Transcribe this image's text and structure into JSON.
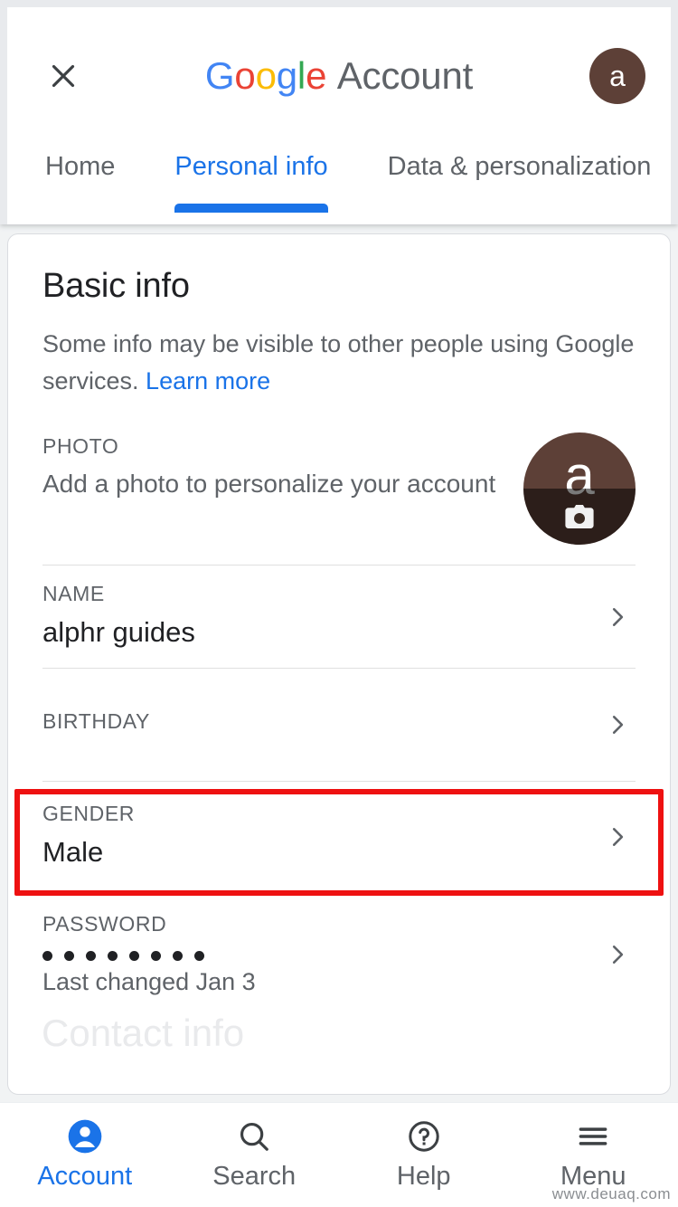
{
  "header": {
    "close_icon": "close-icon",
    "brand_google": "Google",
    "brand_google_letters": [
      "G",
      "o",
      "o",
      "g",
      "l",
      "e"
    ],
    "brand_account": "Account",
    "avatar_letter": "a",
    "avatar_color": "#5d4037"
  },
  "tabs": {
    "items": [
      {
        "label": "Home",
        "active": false
      },
      {
        "label": "Personal info",
        "active": true
      },
      {
        "label": "Data & personalization",
        "active": false
      }
    ],
    "active_color": "#1a73e8"
  },
  "card": {
    "title": "Basic info",
    "description": "Some info may be visible to other people using Google services.",
    "learn_more": "Learn more",
    "rows": {
      "photo": {
        "label": "PHOTO",
        "value": "Add a photo to personalize your account",
        "avatar_letter": "a",
        "camera_icon": "camera-icon"
      },
      "name": {
        "label": "NAME",
        "value": "alphr guides",
        "chevron_icon": "chevron-right-icon"
      },
      "birthday": {
        "label": "BIRTHDAY",
        "value": "",
        "chevron_icon": "chevron-right-icon"
      },
      "gender": {
        "label": "GENDER",
        "value": "Male",
        "chevron_icon": "chevron-right-icon"
      },
      "password": {
        "label": "PASSWORD",
        "masked_value": "••••••••",
        "dot_count": 8,
        "sub": "Last changed Jan 3",
        "chevron_icon": "chevron-right-icon"
      }
    }
  },
  "annotation": {
    "highlight_target": "name-row",
    "color": "#ee1111"
  },
  "ghost_text": "Contact info",
  "bottom_nav": {
    "items": [
      {
        "label": "Account",
        "icon": "person-icon",
        "active": true
      },
      {
        "label": "Search",
        "icon": "search-icon",
        "active": false
      },
      {
        "label": "Help",
        "icon": "help-circle-icon",
        "active": false
      },
      {
        "label": "Menu",
        "icon": "hamburger-menu-icon",
        "active": false
      }
    ]
  },
  "watermark": "www.deuaq.com"
}
